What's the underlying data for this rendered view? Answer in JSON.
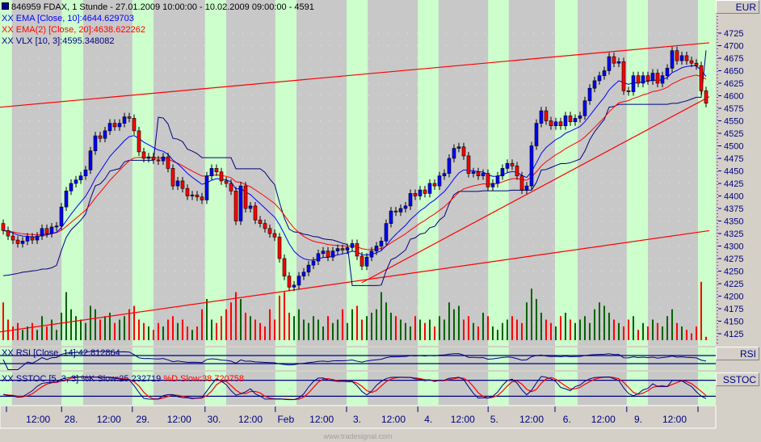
{
  "header": {
    "symbol_line": "846959  FDAX, 1 Stunde - 27.01.2009 10:00:00 - 10.02.2009 09:00:00 - 4591",
    "ema10_label": "XX EMA [Close, 10]:4644.629703",
    "ema20_label": "XX EMA(2) [Close, 20]:4638.622262",
    "vlx_label": "XX VLX [10, 3]:4595.348082",
    "rsi_label": "XX RSI [Close, 14]:42.812864",
    "sstoc_k_label": "XX SSTOC [5, 3, 3] %K Slow:25.232719",
    "sstoc_d_label": "%D Slow:38.720758"
  },
  "axes": {
    "currency": "EUR",
    "rsi_panel": "RSI",
    "sstoc_panel": "SSTOC"
  },
  "watermark": "www.tradesignal.com",
  "colors": {
    "background": "#c8c8c8",
    "session_band": "#ccffcc",
    "up_candle": "#0000ff",
    "down_candle": "#ff0000",
    "ema10": "#0000ff",
    "ema20": "#ff0000",
    "vlx": "#000080",
    "trendline": "#ff0000",
    "volume_up": "#006400",
    "volume_down": "#ff0000"
  },
  "chart_data": {
    "type": "candlestick",
    "title": "846959  FDAX, 1 Stunde - 27.01.2009 10:00:00 - 10.02.2009 09:00:00 - 4591",
    "ylim": [
      4110,
      4745
    ],
    "yticks": [
      4125,
      4150,
      4175,
      4200,
      4225,
      4250,
      4275,
      4300,
      4325,
      4350,
      4375,
      4400,
      4425,
      4450,
      4475,
      4500,
      4525,
      4550,
      4575,
      4600,
      4625,
      4650,
      4675,
      4700,
      4725
    ],
    "first_open": 4345,
    "closes": [
      4331,
      4320,
      4312,
      4305,
      4310,
      4318,
      4312,
      4320,
      4335,
      4325,
      4338,
      4340,
      4378,
      4410,
      4425,
      4432,
      4440,
      4452,
      4490,
      4520,
      4515,
      4530,
      4545,
      4538,
      4545,
      4558,
      4555,
      4530,
      4488,
      4475,
      4478,
      4472,
      4470,
      4478,
      4455,
      4420,
      4430,
      4415,
      4400,
      4402,
      4398,
      4392,
      4440,
      4455,
      4448,
      4430,
      4425,
      4410,
      4350,
      4420,
      4375,
      4380,
      4352,
      4345,
      4335,
      4325,
      4318,
      4275,
      4240,
      4218,
      4222,
      4240,
      4248,
      4262,
      4270,
      4285,
      4290,
      4278,
      4290,
      4295,
      4292,
      4297,
      4305,
      4280,
      4260,
      4278,
      4290,
      4300,
      4310,
      4345,
      4370,
      4368,
      4375,
      4380,
      4405,
      4400,
      4412,
      4405,
      4425,
      4420,
      4440,
      4445,
      4475,
      4495,
      4498,
      4480,
      4445,
      4448,
      4440,
      4445,
      4418,
      4425,
      4440,
      4455,
      4465,
      4460,
      4440,
      4412,
      4420,
      4500,
      4545,
      4570,
      4550,
      4540,
      4548,
      4540,
      4560,
      4548,
      4555,
      4560,
      4590,
      4615,
      4630,
      4640,
      4650,
      4678,
      4665,
      4668,
      4610,
      4608,
      4640,
      4625,
      4640,
      4630,
      4645,
      4625,
      4640,
      4655,
      4690,
      4670,
      4680,
      4670,
      4665,
      4660,
      4610,
      4585
    ],
    "volume_relative": [
      55,
      30,
      20,
      25,
      15,
      20,
      25,
      15,
      35,
      20,
      30,
      15,
      40,
      70,
      45,
      35,
      30,
      25,
      50,
      45,
      30,
      35,
      40,
      25,
      30,
      35,
      45,
      50,
      30,
      25,
      20,
      15,
      25,
      20,
      30,
      35,
      25,
      30,
      20,
      15,
      20,
      45,
      60,
      30,
      25,
      35,
      45,
      55,
      70,
      60,
      40,
      35,
      30,
      25,
      20,
      45,
      30,
      65,
      70,
      40,
      35,
      45,
      30,
      25,
      35,
      30,
      20,
      35,
      25,
      30,
      45,
      25,
      45,
      50,
      30,
      35,
      40,
      45,
      70,
      55,
      40,
      35,
      30,
      25,
      20,
      35,
      30,
      25,
      30,
      20,
      35,
      30,
      55,
      45,
      50,
      30,
      35,
      25,
      20,
      40,
      35,
      20,
      15,
      25,
      30,
      35,
      30,
      25,
      55,
      75,
      60,
      40,
      30,
      25,
      20,
      35,
      40,
      30,
      25,
      30,
      35,
      25,
      45,
      55,
      50,
      40,
      30,
      25,
      20,
      30,
      35,
      15,
      25,
      20,
      30,
      25,
      20,
      35,
      45,
      25,
      20,
      15,
      10,
      20,
      85,
      5
    ],
    "trendlines": [
      {
        "from_bar": 0,
        "from_price": 4578,
        "to_bar": 145,
        "to_price": 4704
      },
      {
        "from_bar": 0,
        "from_price": 4130,
        "to_bar": 145,
        "to_price": 4328
      },
      {
        "from_bar": 74,
        "from_price": 4227,
        "to_bar": 145,
        "to_price": 4588
      }
    ],
    "session_bands_bars": [
      [
        0,
        1.8
      ],
      [
        12.7,
        16.5
      ],
      [
        27.3,
        31
      ],
      [
        42.3,
        46
      ],
      [
        56.8,
        60.5
      ],
      [
        71.5,
        75.2
      ],
      [
        86.2,
        89.8
      ],
      [
        100.7,
        104.3
      ],
      [
        114.5,
        118.5
      ],
      [
        129.3,
        133
      ],
      [
        144,
        147
      ]
    ],
    "xticks": [
      {
        "bar": 7.2,
        "label": "12:00"
      },
      {
        "bar": 14,
        "label": "28."
      },
      {
        "bar": 21.8,
        "label": "12:00"
      },
      {
        "bar": 28.8,
        "label": "29."
      },
      {
        "bar": 36.3,
        "label": "12:00"
      },
      {
        "bar": 43.5,
        "label": "30."
      },
      {
        "bar": 51,
        "label": "12:00"
      },
      {
        "bar": 58.3,
        "label": "Feb"
      },
      {
        "bar": 65.7,
        "label": "12:00"
      },
      {
        "bar": 73,
        "label": "3."
      },
      {
        "bar": 80.5,
        "label": "12:00"
      },
      {
        "bar": 87.7,
        "label": "4."
      },
      {
        "bar": 94.8,
        "label": "12:00"
      },
      {
        "bar": 101.3,
        "label": "5."
      },
      {
        "bar": 109,
        "label": "12:00"
      },
      {
        "bar": 116.3,
        "label": "6."
      },
      {
        "bar": 123.8,
        "label": "12:00"
      },
      {
        "bar": 131,
        "label": "9."
      },
      {
        "bar": 138.5,
        "label": "12:00"
      }
    ],
    "indicators": {
      "ema_periods": [
        10,
        20
      ],
      "vlx": [
        10,
        3
      ],
      "rsi_period": 14,
      "rsi_levels": [
        70,
        30
      ],
      "sstoc": [
        5,
        3,
        3
      ],
      "sstoc_levels": [
        80,
        20
      ]
    }
  }
}
